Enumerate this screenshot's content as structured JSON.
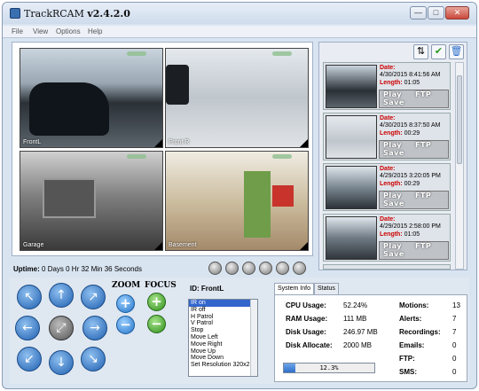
{
  "window": {
    "app_name": "TrackRCAM",
    "version": "v2.4.2.0",
    "minimize_glyph": "—",
    "maximize_glyph": "□",
    "close_glyph": "✕"
  },
  "menu": [
    "File",
    "View",
    "Options",
    "Help"
  ],
  "cameras": [
    {
      "label": "FrontL"
    },
    {
      "label": "Front R"
    },
    {
      "label": "Garage"
    },
    {
      "label": "Basement"
    }
  ],
  "uptime": {
    "label": "Uptime:",
    "value": "0 Days 0 Hr 32 Min 36 Seconds"
  },
  "toolbar_icons": [
    "camera-icon",
    "circle-icon",
    "mail-icon",
    "lightning-icon",
    "triangle-icon",
    "signal-icon"
  ],
  "recordings_toolbar": {
    "sort_glyph": "⇅",
    "ok_glyph": "✔",
    "delete_glyph": "🗑"
  },
  "recordings": [
    {
      "date_label": "Date:",
      "date": "4/30/2015 8:41:56 AM",
      "length_label": "Length:",
      "length": "01:05",
      "play": "Play",
      "ftp": "FTP",
      "save": "Save"
    },
    {
      "date_label": "Date:",
      "date": "4/30/2015 8:37:50 AM",
      "length_label": "Length:",
      "length": "00:29",
      "play": "Play",
      "ftp": "FTP",
      "save": "Save"
    },
    {
      "date_label": "Date:",
      "date": "4/29/2015 3:20:05 PM",
      "length_label": "Length:",
      "length": "00:29",
      "play": "Play",
      "ftp": "FTP",
      "save": "Save"
    },
    {
      "date_label": "Date:",
      "date": "4/29/2015 2:58:00 PM",
      "length_label": "Length:",
      "length": "01:05",
      "play": "Play",
      "ftp": "FTP",
      "save": "Save"
    }
  ],
  "ptz": {
    "arrows": {
      "up_left": "↖",
      "up": "↑",
      "up_right": "↗",
      "left": "←",
      "center": "⤢",
      "right": "→",
      "down_left": "↙",
      "down": "↓",
      "down_right": "↘"
    },
    "zoom_label": "ZOOM",
    "focus_label": "FOCUS",
    "plus": "+",
    "minus": "−"
  },
  "camera_id": {
    "label": "ID:",
    "value": "FrontL"
  },
  "commands": [
    "IR on",
    "IR off",
    "H Patrol",
    "V Patrol",
    "Stop",
    "Move Left",
    "Move Right",
    "Move Up",
    "Move Down",
    "Set Resolution 320x2"
  ],
  "selected_command": "IR on",
  "tabs": [
    "System Info",
    "Status"
  ],
  "system_info": {
    "cpu_label": "CPU Usage:",
    "cpu": "52.24%",
    "ram_label": "RAM Usage:",
    "ram": "111 MB",
    "disk_label": "Disk Usage:",
    "disk": "246.97 MB",
    "alloc_label": "Disk Allocate:",
    "alloc": "2000 MB",
    "disk_progress_text": "12.3%",
    "disk_progress_fraction": 0.123
  },
  "counters": [
    {
      "label": "Motions:",
      "value": "13"
    },
    {
      "label": "Alerts:",
      "value": "7"
    },
    {
      "label": "Recordings:",
      "value": "7"
    },
    {
      "label": "Emails:",
      "value": "0"
    },
    {
      "label": "FTP:",
      "value": "0"
    },
    {
      "label": "SMS:",
      "value": "0"
    }
  ]
}
